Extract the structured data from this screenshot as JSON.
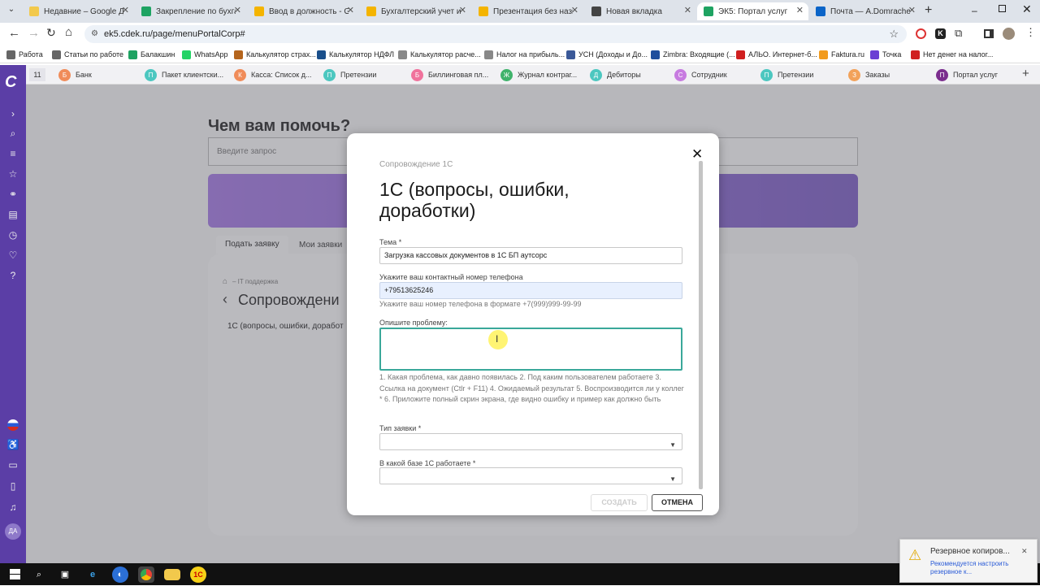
{
  "browser": {
    "tabs": [
      {
        "title": "Недавние – Google Диск",
        "color": "#f2c94c"
      },
      {
        "title": "Закрепление по бухгалте",
        "color": "#1ea362"
      },
      {
        "title": "Ввод в должность - Goog",
        "color": "#f4b400"
      },
      {
        "title": "Бухгалтерский учет и на",
        "color": "#f4b400"
      },
      {
        "title": "Презентация без названи",
        "color": "#f4b400"
      },
      {
        "title": "Новая вкладка",
        "color": "#444444"
      },
      {
        "title": "ЭК5: Портал услуг",
        "color": "#1ea362"
      },
      {
        "title": "Почта — A.Domracheva@",
        "color": "#0a64c8"
      }
    ],
    "new_tab": "+",
    "url": "ek5.cdek.ru/page/menuPortalCorp#",
    "bookmarks": [
      {
        "label": "Работа",
        "color": "#666666"
      },
      {
        "label": "Статьи по работе",
        "color": "#666666"
      },
      {
        "label": "Балакшин",
        "color": "#1ea362"
      },
      {
        "label": "WhatsApp",
        "color": "#25d366"
      },
      {
        "label": "Калькулятор страх...",
        "color": "#b5651d"
      },
      {
        "label": "Калькулятор НДФЛ",
        "color": "#1a4f8b"
      },
      {
        "label": "Калькулятор расче...",
        "color": "#888888"
      },
      {
        "label": "Налог на прибыль...",
        "color": "#888888"
      },
      {
        "label": "УСН (Доходы и До...",
        "color": "#3b5998"
      },
      {
        "label": "Zimbra: Входящие (...",
        "color": "#1f4e9c"
      },
      {
        "label": "АЛЬО. Интернет-б...",
        "color": "#d02020"
      },
      {
        "label": "Faktura.ru",
        "color": "#f29b1d"
      },
      {
        "label": "Точка",
        "color": "#6b3fd4"
      },
      {
        "label": "Нет денег на налог...",
        "color": "#d02020"
      }
    ]
  },
  "app": {
    "tab_count": "11",
    "tabs": [
      {
        "letter": "Б",
        "label": "Банк",
        "color": "#f08c5a"
      },
      {
        "letter": "П",
        "label": "Пакет клиентски...",
        "color": "#4cc7c0"
      },
      {
        "letter": "К",
        "label": "Касса: Список д...",
        "color": "#f08c5a"
      },
      {
        "letter": "П",
        "label": "Претензии",
        "color": "#4cc7c0"
      },
      {
        "letter": "Б",
        "label": "Биллинговая пл...",
        "color": "#f0729c"
      },
      {
        "letter": "Ж",
        "label": "Журнал контраг...",
        "color": "#3fb36b"
      },
      {
        "letter": "Д",
        "label": "Дебиторы",
        "color": "#4cc7c0"
      },
      {
        "letter": "С",
        "label": "Сотрудник",
        "color": "#c77be0"
      },
      {
        "letter": "П",
        "label": "Претензии",
        "color": "#4cc7c0"
      },
      {
        "letter": "З",
        "label": "Заказы",
        "color": "#f2a25a"
      },
      {
        "letter": "П",
        "label": "Портал услуг",
        "color": "#7b2d8e"
      }
    ],
    "avatar": "ДА",
    "page": {
      "heading": "Чем вам помочь?",
      "search_placeholder": "Введите запрос",
      "tab_create": "Подать заявку",
      "tab_my": "Мои заявки",
      "breadcrumb": "– IT поддержка",
      "section_title": "Сопровождени",
      "service_line": "1С (вопросы, ошибки, доработ"
    }
  },
  "modal": {
    "category": "Сопровождение 1С",
    "title": "1С (вопросы, ошибки, доработки)",
    "topic_label": "Тема *",
    "topic_value": "Загрузка кассовых документов в 1С БП аутсорс",
    "phone_label": "Укажите ваш контактный номер телефона",
    "phone_value": "+79513625246",
    "phone_hint": "Укажите ваш номер телефона в формате +7(999)999-99-99",
    "problem_label": "Опишите проблему:",
    "problem_value": "",
    "problem_hint": "1. Какая проблема, как давно появилась 2. Под каким пользователем работаете 3. Ссылка на документ (Ctlr + F11) 4. Ожидаемый результат 5. Воспроизводится ли у коллег * 6. Приложите полный скрин экрана, где видно ошибку и пример как должно быть",
    "type_label": "Тип заявки *",
    "base_label": "В какой базе 1С работаете *",
    "create_button": "СОЗДАТЬ",
    "cancel_button": "ОТМЕНА"
  },
  "notification": {
    "title": "Резервное копиров...",
    "text": "Рекомендуется настроить резервное к..."
  }
}
